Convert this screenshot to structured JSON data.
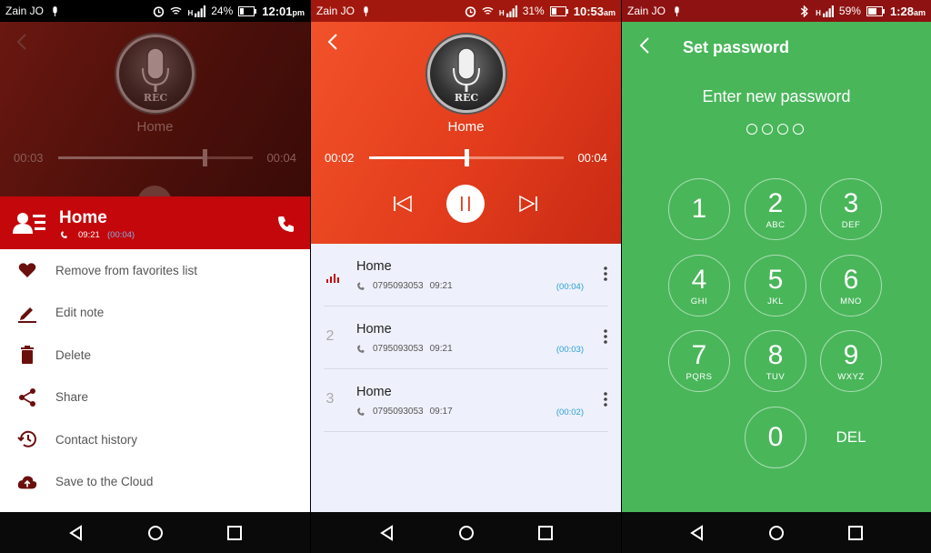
{
  "status_bars": [
    {
      "carrier": "Zain JO",
      "network": "H",
      "battery": "24%",
      "time": "12:01",
      "ampm": "pm"
    },
    {
      "carrier": "Zain JO",
      "network": "H",
      "battery": "31%",
      "time": "10:53",
      "ampm": "am"
    },
    {
      "carrier": "Zain JO",
      "network": "H",
      "battery": "59%",
      "time": "1:28",
      "ampm": "am"
    }
  ],
  "panel1": {
    "contact_label": "Home",
    "elapsed": "00:03",
    "total": "00:04",
    "seek_progress": 0.75,
    "contact_bar": {
      "name": "Home",
      "time": "09:21",
      "duration": "(00:04)"
    },
    "menu": [
      {
        "label": "Remove from favorites list",
        "icon": "heart-icon"
      },
      {
        "label": "Edit note",
        "icon": "pencil-icon"
      },
      {
        "label": "Delete",
        "icon": "trash-icon"
      },
      {
        "label": "Share",
        "icon": "share-icon"
      },
      {
        "label": "Contact history",
        "icon": "history-icon"
      },
      {
        "label": "Save to the Cloud",
        "icon": "cloud-upload-icon"
      }
    ]
  },
  "panel2": {
    "contact_label": "Home",
    "elapsed": "00:02",
    "total": "00:04",
    "seek_progress": 0.5,
    "recordings": [
      {
        "index": "",
        "name": "Home",
        "number": "0795093053",
        "time": "09:21",
        "duration": "(00:04)",
        "playing": true
      },
      {
        "index": "2",
        "name": "Home",
        "number": "0795093053",
        "time": "09:21",
        "duration": "(00:03)",
        "playing": false
      },
      {
        "index": "3",
        "name": "Home",
        "number": "0795093053",
        "time": "09:17",
        "duration": "(00:02)",
        "playing": false
      }
    ]
  },
  "panel3": {
    "title": "Set password",
    "prompt": "Enter new password",
    "keys": [
      {
        "num": "1",
        "sub": ""
      },
      {
        "num": "2",
        "sub": "ABC"
      },
      {
        "num": "3",
        "sub": "DEF"
      },
      {
        "num": "4",
        "sub": "GHI"
      },
      {
        "num": "5",
        "sub": "JKL"
      },
      {
        "num": "6",
        "sub": "MNO"
      },
      {
        "num": "7",
        "sub": "PQRS"
      },
      {
        "num": "8",
        "sub": "TUV"
      },
      {
        "num": "9",
        "sub": "WXYZ"
      },
      {
        "num": "0",
        "sub": ""
      }
    ],
    "del_label": "DEL"
  },
  "colors": {
    "accent_red": "#c4070b",
    "accent_orange": "#e23c1c",
    "green_bg": "#49b65a",
    "duration_blue": "#2a9fd6"
  }
}
